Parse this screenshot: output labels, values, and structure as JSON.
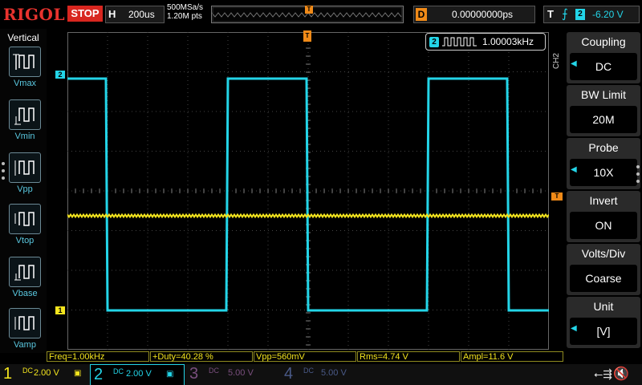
{
  "topbar": {
    "logo": "RIGOL",
    "run_state": "STOP",
    "horizontal_label": "H",
    "timebase": "200us",
    "sample_rate": "500MSa/s",
    "memory_depth": "1.20M pts",
    "delay_label": "D",
    "delay_value": "0.00000000ps",
    "trigger_label": "T",
    "trigger_edge": "rising-edge-icon",
    "trigger_source": "2",
    "trigger_level": "-6.20 V",
    "trigger_marker": "T"
  },
  "left_panel": {
    "title": "Vertical",
    "items": [
      {
        "label": "Vmax",
        "icon": "vmax-icon"
      },
      {
        "label": "Vmin",
        "icon": "vmin-icon"
      },
      {
        "label": "Vpp",
        "icon": "vpp-icon"
      },
      {
        "label": "Vtop",
        "icon": "vtop-icon"
      },
      {
        "label": "Vbase",
        "icon": "vbase-icon"
      },
      {
        "label": "Vamp",
        "icon": "vamp-icon"
      }
    ]
  },
  "waveform": {
    "ch2_marker": "2",
    "ch1_marker": "1",
    "trigger_marker": "T",
    "freq_counter_channel": "2",
    "freq_counter_value": "1.00003kHz",
    "ch2_color": "#23d5e8",
    "ch1_color": "#f4e51e"
  },
  "right_menu": {
    "channel_tag": "CH2",
    "items": [
      {
        "title": "Coupling",
        "value": "DC",
        "has_arrow": true
      },
      {
        "title": "BW Limit",
        "value": "20M",
        "has_arrow": false
      },
      {
        "title": "Probe",
        "value": "10X",
        "has_arrow": true
      },
      {
        "title": "Invert",
        "value": "ON",
        "has_arrow": false
      },
      {
        "title": "Volts/Div",
        "value": "Coarse",
        "has_arrow": false
      },
      {
        "title": "Unit",
        "value": "[V]",
        "has_arrow": true
      }
    ]
  },
  "measurements": [
    {
      "label": "Freq=1.00kHz"
    },
    {
      "label": "+Duty=40.28 %"
    },
    {
      "label": "Vpp=560mV"
    },
    {
      "label": "Rms=4.74 V"
    },
    {
      "label": "Ampl=11.6 V"
    }
  ],
  "channels": [
    {
      "num": "1",
      "coupling": "DC",
      "scale": "2.00 V"
    },
    {
      "num": "2",
      "coupling": "DC",
      "scale": "2.00 V"
    },
    {
      "num": "3",
      "coupling": "DC",
      "scale": "5.00 V"
    },
    {
      "num": "4",
      "coupling": "DC",
      "scale": "5.00 V"
    }
  ]
}
